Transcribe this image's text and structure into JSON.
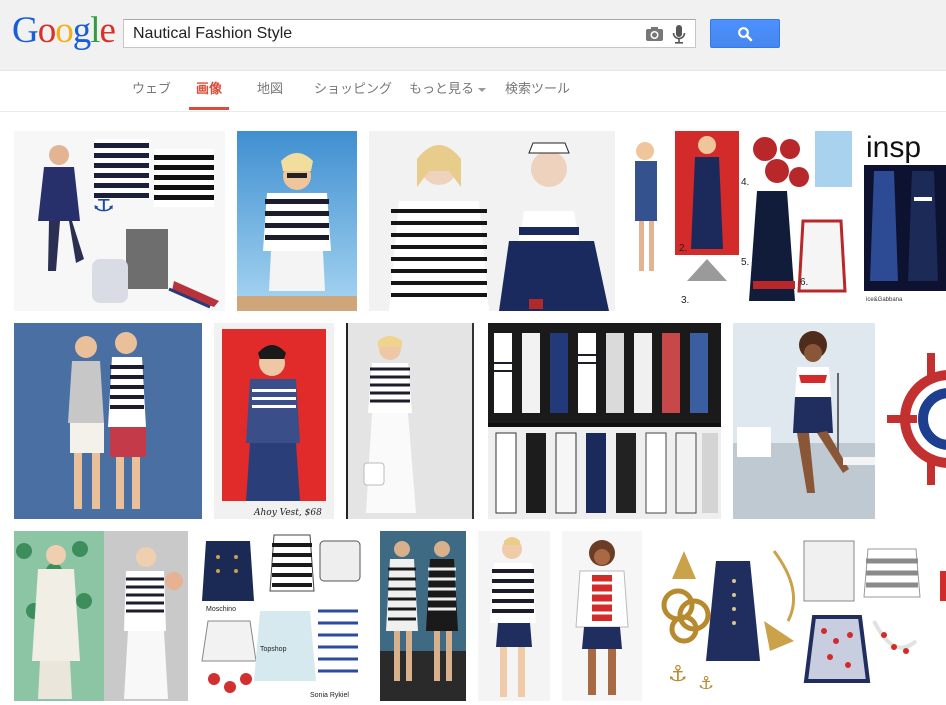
{
  "logo": {
    "text": "Google",
    "letters": [
      "G",
      "o",
      "o",
      "g",
      "l",
      "e"
    ],
    "colors": [
      "#1a5dd8",
      "#d8302a",
      "#f2b21a",
      "#1a5dd8",
      "#2f9e3f",
      "#d8302a"
    ]
  },
  "search": {
    "query": "Nautical Fashion Style",
    "placeholder": ""
  },
  "icons": {
    "camera": "camera-icon",
    "mic": "mic-icon",
    "search": "search-icon"
  },
  "tabs": [
    {
      "label": "ウェブ"
    },
    {
      "label": "画像"
    },
    {
      "label": "地図"
    },
    {
      "label": "ショッピング"
    },
    {
      "label": "もっと見る"
    },
    {
      "label": "検索ツール"
    }
  ],
  "accent": "#dd4b39",
  "button_color": "#4d90fe",
  "images": [
    {
      "caption": "",
      "labels": []
    },
    {
      "caption": "",
      "labels": []
    },
    {
      "caption": "",
      "labels": []
    },
    {
      "caption": "",
      "labels": [
        "2.",
        "3.",
        "4.",
        "5.",
        "6."
      ]
    },
    {
      "caption": "insp",
      "labels": [
        "ice&Gabbana"
      ]
    },
    {
      "caption": "",
      "labels": []
    },
    {
      "caption": "Ahoy Vest, $68",
      "labels": []
    },
    {
      "caption": "",
      "labels": []
    },
    {
      "caption": "",
      "labels": []
    },
    {
      "caption": "",
      "labels": []
    },
    {
      "caption": "",
      "labels": []
    },
    {
      "caption": "",
      "labels": []
    },
    {
      "caption": "",
      "labels": [
        "Moschino",
        "Topshop",
        "Sonia Rykiel"
      ]
    },
    {
      "caption": "",
      "labels": []
    },
    {
      "caption": "",
      "labels": []
    },
    {
      "caption": "",
      "labels": []
    }
  ]
}
